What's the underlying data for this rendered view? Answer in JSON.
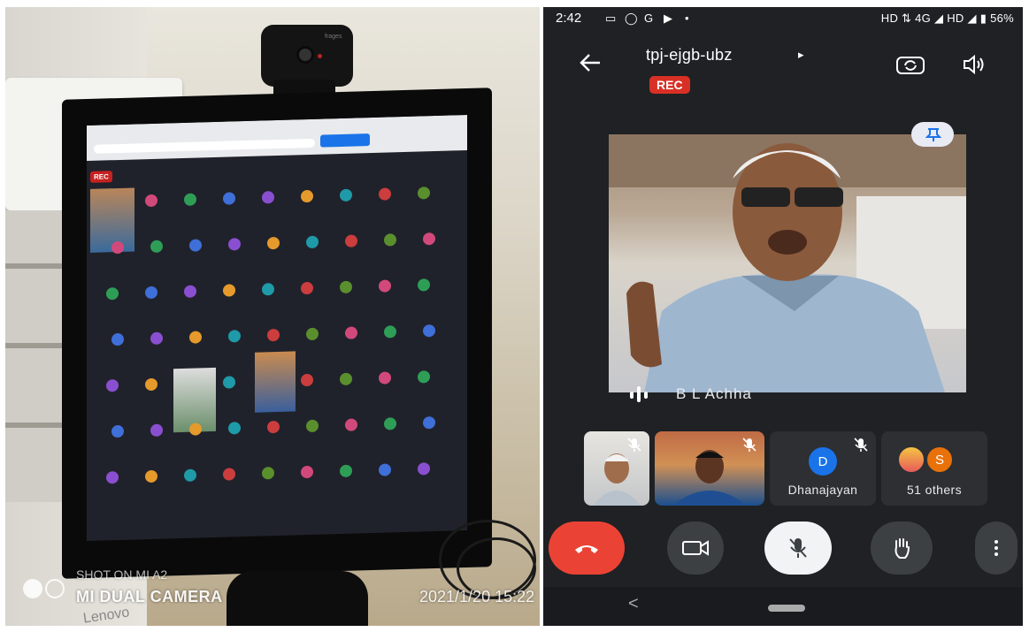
{
  "photo": {
    "webcam_brand": "frages",
    "rec_label": "REC",
    "monitor_brand": "Lenovo",
    "watermark_line1": "SHOT ON MI A2",
    "watermark_line2": "MI DUAL CAMERA",
    "timestamp": "2021/1/20 15:22"
  },
  "phone": {
    "status": {
      "time": "2:42",
      "right": "HD ⇅ 4G ◢ HD ◢ ▮ 56%"
    },
    "meeting_code": "tpj-ejgb-ubz",
    "caret": "▸",
    "rec_badge": "REC",
    "main_speaker": "B L Achha",
    "tiles": [
      {
        "label": ""
      },
      {
        "label": ""
      },
      {
        "label": "Dhanajayan",
        "avatar_letter": "D"
      },
      {
        "label": "51 others",
        "avatar_letter": "S"
      }
    ],
    "nav": {
      "back": "<"
    },
    "colors": {
      "rec": "#d93025",
      "end_call": "#ea4335",
      "avatar_d": "#1a73e8",
      "avatar_s": "#e8710a",
      "background": "#1f2124"
    },
    "icons": [
      "back-arrow-icon",
      "camera-switch-icon",
      "speaker-icon",
      "pin-icon",
      "audio-bars-icon",
      "mic-off-icon",
      "end-call-icon",
      "camera-icon",
      "raise-hand-icon",
      "more-vert-icon"
    ]
  }
}
